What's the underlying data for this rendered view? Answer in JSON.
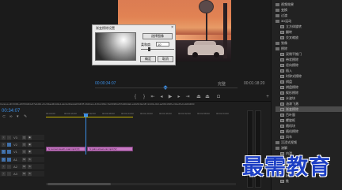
{
  "monitor": {
    "current_time": "00:00:34:07",
    "fit_label": "完整",
    "duration": "00:01:18:20"
  },
  "dialog": {
    "title": "渐变擦除设置",
    "select_image_button": "选择图像",
    "softness_label": "柔和度:",
    "softness_value": "10",
    "ok_button": "确定",
    "cancel_button": "取消",
    "close_glyph": "×"
  },
  "timeline": {
    "current_time": "00:34:07",
    "sequence_tabs_text": "Cannes-HD 6000+2D700d04+87e2d4b-e5-c64ae9b4d4e1+Ec2e30ad+Eb5df1f5  4fd41ec+41f4+f4b9c-Tac9b98cef67a6b0dab-e2d26c0e2d5  4cd43+4b2-ae5bb1b9ff+c34ed5+Fe3d0d000",
    "ruler_labels": [
      "00:00:00",
      "00:00:16:00",
      "00:00:32:00",
      "00:00:48:00",
      "00:01:04:00",
      "00:01:20:00",
      "00:01:36:00",
      "00:01:52:00",
      "00:02:08:00",
      "00:02:24:00",
      "00:02:40:00"
    ],
    "tracks": [
      {
        "name": "V3"
      },
      {
        "name": "V2"
      },
      {
        "name": "V1"
      },
      {
        "name": "A1"
      },
      {
        "name": "A2"
      },
      {
        "name": "A3"
      }
    ],
    "clips": [
      {
        "label": "fx  sunset-beach-road.mp4 [V]"
      },
      {
        "label": "fx  palm-street-car.mp4 [V]"
      }
    ]
  },
  "effects_panel": {
    "items": [
      {
        "label": "视频效果",
        "type": "folder"
      },
      {
        "label": "变换",
        "type": "folder"
      },
      {
        "label": "过渡",
        "type": "folder"
      },
      {
        "label": "3D运动",
        "type": "folder"
      },
      {
        "label": "立方体旋转",
        "type": "item"
      },
      {
        "label": "翻转",
        "type": "item"
      },
      {
        "label": "交叉缩放",
        "type": "item"
      },
      {
        "label": "划像",
        "type": "folder"
      },
      {
        "label": "擦除",
        "type": "folder"
      },
      {
        "label": "双侧平推门",
        "type": "item"
      },
      {
        "label": "带状擦除",
        "type": "item"
      },
      {
        "label": "径向擦除",
        "type": "item"
      },
      {
        "label": "插入",
        "type": "item"
      },
      {
        "label": "时钟式擦除",
        "type": "item"
      },
      {
        "label": "棋盘",
        "type": "item"
      },
      {
        "label": "棋盘擦除",
        "type": "item"
      },
      {
        "label": "楔形擦除",
        "type": "item"
      },
      {
        "label": "水波块",
        "type": "item"
      },
      {
        "label": "油漆飞溅",
        "type": "item"
      },
      {
        "label": "渐变擦除",
        "type": "item",
        "selected": true
      },
      {
        "label": "百叶窗",
        "type": "item"
      },
      {
        "label": "螺旋框",
        "type": "item"
      },
      {
        "label": "随机块",
        "type": "item"
      },
      {
        "label": "随机擦除",
        "type": "item"
      },
      {
        "label": "风车",
        "type": "item"
      },
      {
        "label": "沉浸式视频",
        "type": "folder"
      },
      {
        "label": "溶解",
        "type": "folder"
      },
      {
        "label": "内滑",
        "type": "item"
      },
      {
        "label": "中心拆分",
        "type": "item"
      },
      {
        "label": "内滑",
        "type": "item"
      },
      {
        "label": "带状内滑",
        "type": "item"
      },
      {
        "label": "拆分",
        "type": "item"
      },
      {
        "label": "推",
        "type": "item"
      }
    ]
  },
  "watermark": {
    "text": "最需教育"
  },
  "colors": {
    "accent": "#3a8ee6",
    "clip": "#c77ac3",
    "watermark": "#1d3fc4"
  }
}
